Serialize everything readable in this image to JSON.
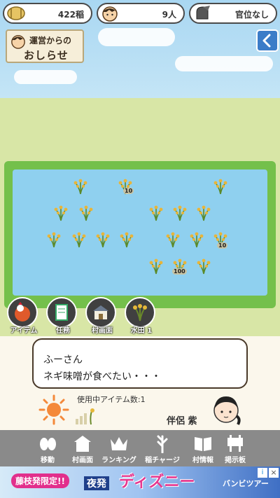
{
  "status": {
    "rice_count": "422",
    "rice_unit": "稲",
    "people_count": "9",
    "people_unit": "人",
    "rank": "官位なし"
  },
  "notice": {
    "line1": "運営からの",
    "line2": "おしらせ"
  },
  "field": {
    "badges": [
      "10",
      "10",
      "100"
    ]
  },
  "actions": [
    {
      "label": "アイテム"
    },
    {
      "label": "任務"
    },
    {
      "label": "村画面"
    },
    {
      "label": "水田 1"
    }
  ],
  "message": {
    "speaker": "ふーさん",
    "text": "ネギ味噌が食べたい・・・",
    "usage": "使用中アイテム数:1",
    "partner": "伴侶 紫"
  },
  "nav": [
    {
      "label": "移動",
      "icon": "move-icon"
    },
    {
      "label": "村画面",
      "icon": "village-icon"
    },
    {
      "label": "ランキング",
      "icon": "crown-icon"
    },
    {
      "label": "稲チャージ",
      "icon": "rice-charge-icon"
    },
    {
      "label": "村情報",
      "icon": "book-icon"
    },
    {
      "label": "掲示板",
      "icon": "board-icon"
    }
  ],
  "ad": {
    "badge": "藤枝発限定!!",
    "night": "夜発",
    "brand": "ディズニー",
    "sub": "バンビツアー"
  },
  "colors": {
    "nav_bg": "#8a8a8a",
    "back_btn": "#3b7cc8",
    "field_green": "#74c04b",
    "water": "#8fd0ef"
  }
}
